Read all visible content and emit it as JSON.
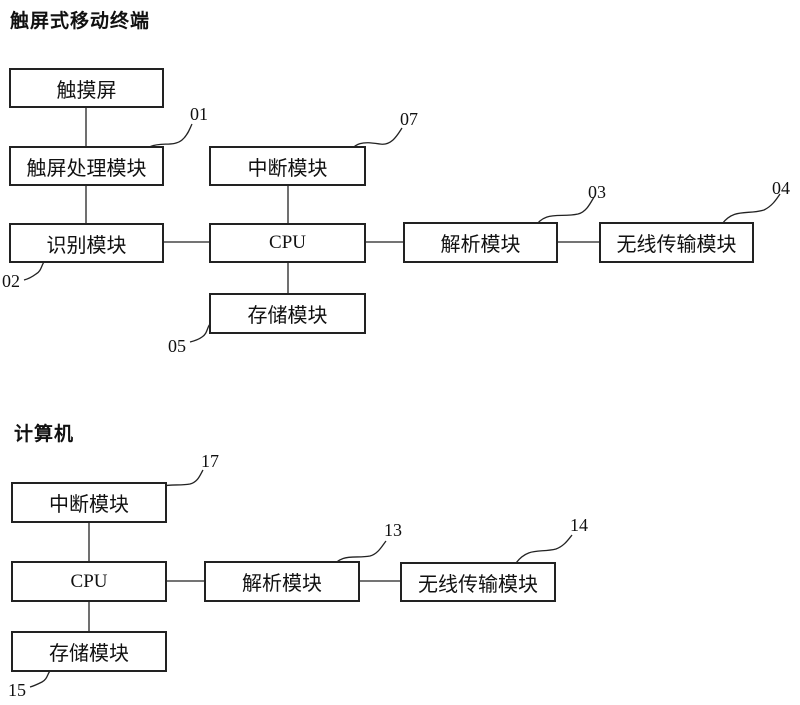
{
  "mobile_terminal": {
    "title": "触屏式移动终端",
    "blocks": {
      "touch_screen": "触摸屏",
      "touch_processing": "触屏处理模块",
      "interrupt": "中断模块",
      "recognition": "识别模块",
      "cpu": "CPU",
      "parsing": "解析模块",
      "wireless": "无线传输模块",
      "storage": "存储模块"
    },
    "refs": {
      "touch_processing": "01",
      "recognition": "02",
      "parsing": "03",
      "wireless": "04",
      "storage": "05",
      "interrupt": "07"
    }
  },
  "computer": {
    "title": "计算机",
    "blocks": {
      "interrupt": "中断模块",
      "cpu": "CPU",
      "parsing": "解析模块",
      "wireless": "无线传输模块",
      "storage": "存储模块"
    },
    "refs": {
      "parsing": "13",
      "wireless": "14",
      "storage": "15",
      "interrupt": "17"
    }
  }
}
